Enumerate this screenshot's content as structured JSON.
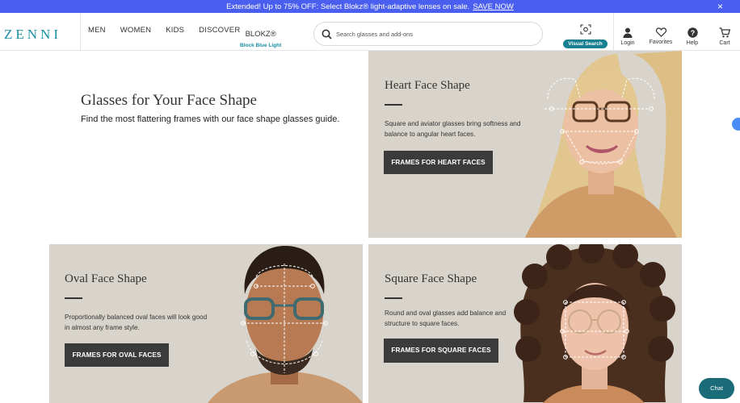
{
  "promo": {
    "text": "Extended! Up to 75% OFF: Select Blokz® light-adaptive lenses on sale.",
    "link": "SAVE NOW",
    "close": "×"
  },
  "header": {
    "logo": "ZENNI",
    "nav": [
      "MEN",
      "WOMEN",
      "KIDS",
      "DISCOVER"
    ],
    "blokz": {
      "label": "BLOKZ®",
      "sub": "Block Blue Light"
    },
    "search_placeholder": "Search glasses and add-ons",
    "visual_search": "Visual Search",
    "login": "Login",
    "favorites": "Favorites",
    "help": "Help",
    "cart": "Cart"
  },
  "hero": {
    "title": "Glasses for Your Face Shape",
    "subtitle": "Find the most flattering frames with our face shape glasses guide."
  },
  "cards": {
    "heart": {
      "title": "Heart Face Shape",
      "desc": "Square and aviator glasses bring softness and balance to angular heart faces.",
      "button": "FRAMES FOR HEART FACES"
    },
    "oval": {
      "title": "Oval Face Shape",
      "desc": "Proportionally balanced oval faces will look good in almost any frame style.",
      "button": "FRAMES FOR OVAL FACES"
    },
    "square": {
      "title": "Square Face Shape",
      "desc": "Round and oval glasses add balance and structure to square faces.",
      "button": "FRAMES FOR SQUARE FACES"
    }
  },
  "chat": "Chat",
  "colors": {
    "accent": "#4a5ff0",
    "brand": "#1a8fa3",
    "card_bg": "#d8d4cc",
    "button": "#3b3b3b"
  }
}
